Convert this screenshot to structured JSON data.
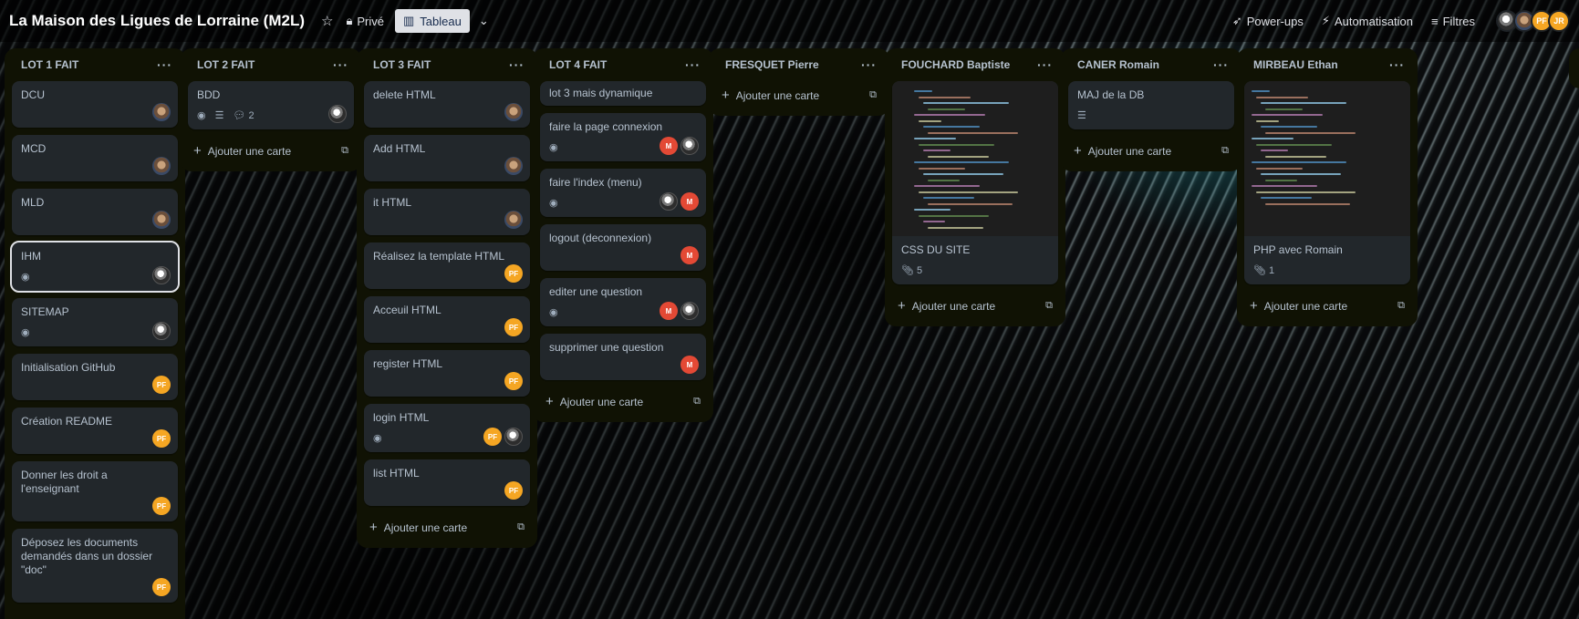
{
  "header": {
    "board_title": "La Maison des Ligues de Lorraine (M2L)",
    "visibility_label": "Privé",
    "view_label": "Tableau",
    "powerups_label": "Power-ups",
    "automation_label": "Automatisation",
    "filters_label": "Filtres",
    "members": [
      {
        "type": "photo",
        "initials": ""
      },
      {
        "type": "photo2",
        "initials": ""
      },
      {
        "type": "pf",
        "initials": "PF"
      },
      {
        "type": "jr",
        "initials": "JR"
      }
    ]
  },
  "lists": [
    {
      "title": "LOT 1 FAIT",
      "add_label": "Ajouter une carte",
      "cards": [
        {
          "title": "DCU",
          "members": [
            {
              "type": "photo2",
              "initials": ""
            }
          ]
        },
        {
          "title": "MCD",
          "members": [
            {
              "type": "photo2",
              "initials": ""
            }
          ]
        },
        {
          "title": "MLD",
          "members": [
            {
              "type": "photo2",
              "initials": ""
            }
          ]
        },
        {
          "title": "IHM",
          "watch": true,
          "selected": true,
          "members": [
            {
              "type": "photo",
              "initials": ""
            }
          ]
        },
        {
          "title": "SITEMAP",
          "watch": true,
          "members": [
            {
              "type": "photo",
              "initials": ""
            }
          ]
        },
        {
          "title": "Initialisation GitHub",
          "members": [
            {
              "type": "pf",
              "initials": "PF"
            }
          ]
        },
        {
          "title": "Création README",
          "members": [
            {
              "type": "pf",
              "initials": "PF"
            }
          ]
        },
        {
          "title": "Donner les droit a l'enseignant",
          "members": [
            {
              "type": "pf",
              "initials": "PF"
            }
          ]
        },
        {
          "title": "Déposez les documents demandés dans un dossier \"doc\"",
          "members": [
            {
              "type": "pf",
              "initials": "PF"
            }
          ]
        }
      ]
    },
    {
      "title": "LOT 2 FAIT",
      "add_label": "Ajouter une carte",
      "cards": [
        {
          "title": "BDD",
          "watch": true,
          "description": true,
          "comments": "2",
          "members": [
            {
              "type": "photo",
              "initials": ""
            }
          ]
        }
      ]
    },
    {
      "title": "LOT 3 FAIT",
      "add_label": "Ajouter une carte",
      "cards": [
        {
          "title": "delete HTML",
          "members": [
            {
              "type": "photo2",
              "initials": ""
            }
          ]
        },
        {
          "title": "Add HTML",
          "members": [
            {
              "type": "photo2",
              "initials": ""
            }
          ]
        },
        {
          "title": "it HTML",
          "members": [
            {
              "type": "photo2",
              "initials": ""
            }
          ]
        },
        {
          "title": "Réalisez la template HTML",
          "members": [
            {
              "type": "pf",
              "initials": "PF"
            }
          ]
        },
        {
          "title": "Acceuil HTML",
          "members": [
            {
              "type": "pf",
              "initials": "PF"
            }
          ]
        },
        {
          "title": "register HTML",
          "members": [
            {
              "type": "pf",
              "initials": "PF"
            }
          ]
        },
        {
          "title": "login HTML",
          "watch": true,
          "members": [
            {
              "type": "pf",
              "initials": "PF"
            },
            {
              "type": "photo",
              "initials": ""
            }
          ]
        },
        {
          "title": "list HTML",
          "members": [
            {
              "type": "pf",
              "initials": "PF"
            }
          ]
        }
      ]
    },
    {
      "title": "LOT 4 FAIT",
      "add_label": "Ajouter une carte",
      "cards": [
        {
          "title": "lot 3 mais dynamique",
          "compact": true,
          "members": []
        },
        {
          "title": "faire la page connexion",
          "watch": true,
          "members": [
            {
              "type": "m",
              "initials": "M"
            },
            {
              "type": "photo",
              "initials": ""
            }
          ]
        },
        {
          "title": "faire l'index (menu)",
          "watch": true,
          "members": [
            {
              "type": "photo",
              "initials": ""
            },
            {
              "type": "m",
              "initials": "M"
            }
          ]
        },
        {
          "title": "logout (deconnexion)",
          "members": [
            {
              "type": "m",
              "initials": "M"
            }
          ]
        },
        {
          "title": "editer une question",
          "watch": true,
          "members": [
            {
              "type": "m",
              "initials": "M"
            },
            {
              "type": "photo",
              "initials": ""
            }
          ]
        },
        {
          "title": "supprimer une question",
          "members": [
            {
              "type": "m",
              "initials": "M"
            }
          ]
        }
      ]
    },
    {
      "title": "FRESQUET Pierre",
      "add_label": "Ajouter une carte",
      "cards": []
    },
    {
      "title": "FOUCHARD Baptiste",
      "add_label": "Ajouter une carte",
      "cards": [
        {
          "title": "CSS DU SITE",
          "cover": "css",
          "attachments": "5",
          "members": []
        }
      ]
    },
    {
      "title": "CANER Romain",
      "add_label": "Ajouter une carte",
      "cards": [
        {
          "title": "MAJ de la DB",
          "description": true,
          "members": []
        }
      ]
    },
    {
      "title": "MIRBEAU Ethan",
      "add_label": "Ajouter une carte",
      "cards": [
        {
          "title": "PHP avec Romain",
          "cover": "php",
          "attachments": "1",
          "members": []
        }
      ]
    }
  ],
  "colors": {
    "list_bg": "#101204",
    "card_bg": "#22272b",
    "pf_avatar": "#f5a623",
    "m_avatar": "#e34935"
  }
}
